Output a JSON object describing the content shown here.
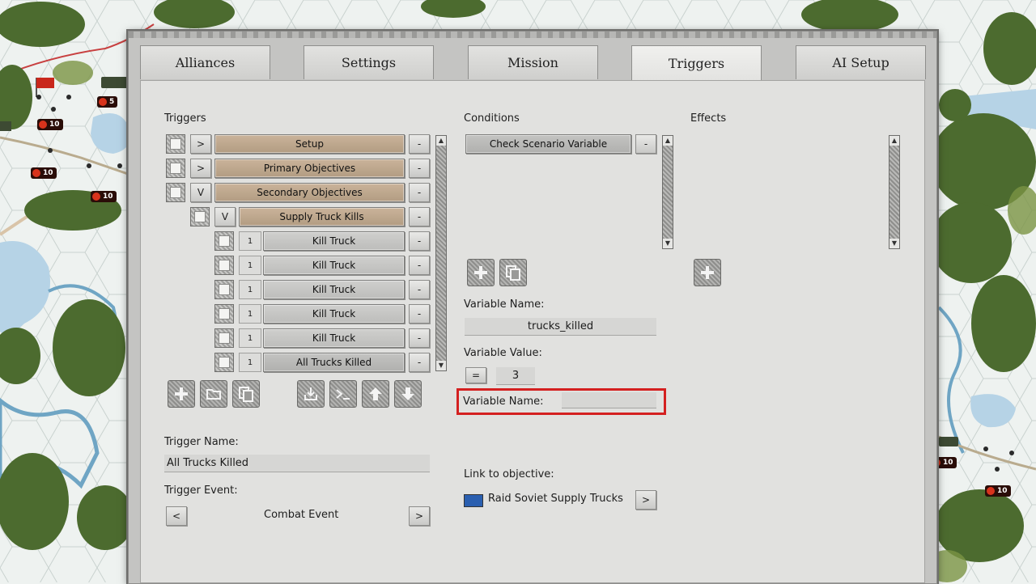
{
  "tabs": [
    {
      "label": "Alliances",
      "active": false
    },
    {
      "label": "Settings",
      "active": false
    },
    {
      "label": "Mission",
      "active": false
    },
    {
      "label": "Triggers",
      "active": true
    },
    {
      "label": "AI Setup",
      "active": false
    }
  ],
  "map": {
    "unit_badges": [
      "5",
      "10",
      "10",
      "10",
      "10",
      "10"
    ]
  },
  "triggers": {
    "header": "Triggers",
    "rows": [
      {
        "toggle": ">",
        "label": "Setup",
        "style": "brown",
        "remove": "-"
      },
      {
        "toggle": ">",
        "label": "Primary Objectives",
        "style": "brown",
        "remove": "-"
      },
      {
        "toggle": "V",
        "label": "Secondary Objectives",
        "style": "brown",
        "remove": "-"
      },
      {
        "toggle": "V",
        "label": "Supply Truck Kills",
        "style": "brown",
        "remove": "-"
      },
      {
        "toggle": "1",
        "label": "Kill Truck",
        "style": "grey",
        "remove": "-"
      },
      {
        "toggle": "1",
        "label": "Kill Truck",
        "style": "grey",
        "remove": "-"
      },
      {
        "toggle": "1",
        "label": "Kill Truck",
        "style": "grey",
        "remove": "-"
      },
      {
        "toggle": "1",
        "label": "Kill Truck",
        "style": "grey",
        "remove": "-"
      },
      {
        "toggle": "1",
        "label": "Kill Truck",
        "style": "grey",
        "remove": "-"
      },
      {
        "toggle": "1",
        "label": "All Trucks Killed",
        "style": "selected",
        "remove": "-"
      }
    ],
    "toolbar_icons": [
      "add-icon",
      "folder-icon",
      "copy-icon",
      "import-icon",
      "console-icon",
      "move-up-icon",
      "move-down-icon"
    ],
    "name_label": "Trigger Name:",
    "name_value": "All Trucks Killed",
    "event_label": "Trigger Event:",
    "event_value": "Combat Event",
    "prev": "<",
    "next": ">"
  },
  "conditions": {
    "header": "Conditions",
    "items": [
      {
        "label": "Check Scenario Variable",
        "remove": "-"
      }
    ],
    "variable_name_label": "Variable Name:",
    "variable_name_value": "trucks_killed",
    "variable_value_label": "Variable Value:",
    "operator": "=",
    "variable_value": "3",
    "highlight_label": "Variable Name:",
    "highlight_value": "",
    "highlight_color": "#d42020",
    "objective_label": "Link to objective:",
    "objective_value": "Raid Soviet Supply Trucks",
    "objective_color": "#2a5fb0",
    "objective_next": ">"
  },
  "effects": {
    "header": "Effects"
  }
}
